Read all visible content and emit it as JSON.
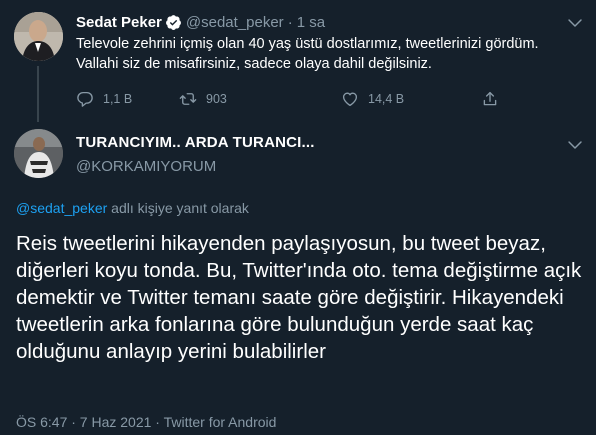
{
  "parent_tweet": {
    "author_name": "Sedat Peker",
    "verified": true,
    "handle": "@sedat_peker",
    "separator": "·",
    "time": "1 sa",
    "text": "Televole zehrini içmiş olan 40 yaş üstü dostlarımız, tweetlerinizi gördüm. Vallahi siz de misafirsiniz, sadece olaya dahil değilsiniz.",
    "actions": {
      "reply_count": "1,1 B",
      "retweet_count": "903",
      "like_count": "14,4 B"
    }
  },
  "reply_tweet": {
    "author_name": "TURANCIYIM.. ARDA TURANCI...",
    "handle": "@KORKAMIYORUM",
    "replying_to_mention": "@sedat_peker",
    "replying_to_suffix": " adlı kişiye yanıt olarak",
    "text": "Reis tweetlerini hikayenden paylaşıyosun, bu tweet beyaz, diğerleri koyu tonda. Bu, Twitter'ında oto. tema değiştirme açık demektir ve Twitter temanı saate göre değiştirir. Hikayendeki tweetlerin arka fonlarına göre bulunduğun yerde saat kaç olduğunu anlayıp yerini bulabilirler",
    "meta": "ÖS 6:47 · 7 Haz 2021 · Twitter for Android"
  },
  "colors": {
    "background": "#15202b",
    "text_primary": "#ffffff",
    "text_secondary": "#8899a6",
    "accent": "#1da1f2",
    "thread_line": "#38444d"
  }
}
